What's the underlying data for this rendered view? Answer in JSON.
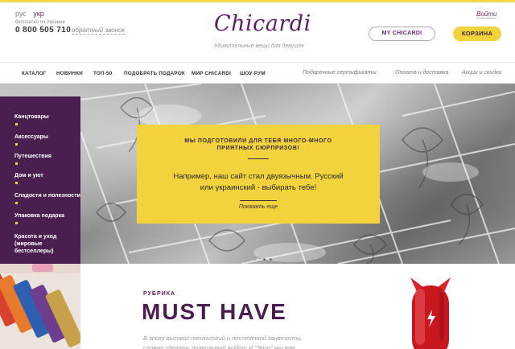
{
  "header": {
    "languages": [
      "рус",
      "укр"
    ],
    "free_call_note": "бесплатно по Украине",
    "phone": "0 800 505 710",
    "callback": "обратный звонок",
    "logo": "Chicardi",
    "tagline": "Удивительные вещи для девушек",
    "login": "Войти",
    "my_account_button": "MY CHICARDI",
    "cart_button": "КОРЗИНА"
  },
  "nav": {
    "items": [
      "КАТАЛОГ",
      "НОВИНКИ",
      "ТОП-50",
      "ПОДОБРАТЬ ПОДАРОК",
      "МИР CHICARDI",
      "ШОУ-РУМ"
    ],
    "secondary": [
      "Подарочные сертификаты",
      "Оплата и доставка",
      "Акции и скидки"
    ]
  },
  "sidebar": {
    "items": [
      "Канцтовары",
      "Аксессуары",
      "Путешествия",
      "Дом и уют",
      "Сладости и полезности",
      "Упаковка подарка",
      "Красота и уход (мировые бестселлеры)"
    ]
  },
  "promo": {
    "title": "МЫ ПОДГОТОВИЛИ ДЛЯ ТЕБЯ МНОГО-МНОГО ПРИЯТНЫХ СЮРПРИЗОВ!",
    "text": "Например, наш сайт стал двуязычным. Русский или украинский - выбирать тебе!",
    "link": "Показать еще"
  },
  "section": {
    "rubric": "РУБРИКА",
    "title": "MUST HAVE",
    "intro": "В эпоху высоких технологий и постоянной занятости, сложно сделать правильный выбор! И \"Эрго\" мы вам помогаем"
  },
  "colors": {
    "brand": "#4a1f4f",
    "accent": "#f2d23d"
  }
}
